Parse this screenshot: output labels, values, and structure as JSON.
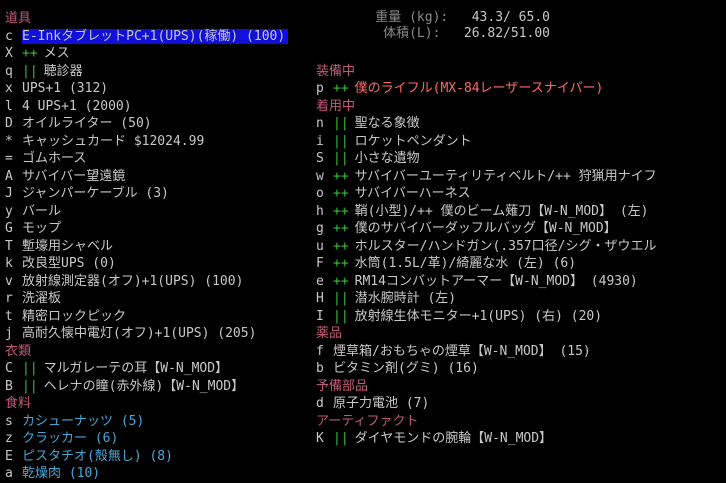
{
  "stats": {
    "weight_label": "重量 (kg):",
    "weight_value": "43.3/ 65.0",
    "volume_label": "体積(L):",
    "volume_value": "26.82/51.00"
  },
  "colors": {
    "background": "#000000",
    "section_header": "#c25a7a",
    "selection_bg": "#1010d8",
    "marker_green": "#3cbf3c",
    "item_default": "#c8c8c8",
    "item_red": "#ff6a6a",
    "item_cyan": "#48a8d8"
  },
  "left": [
    {
      "type": "section",
      "label": "道具"
    },
    {
      "type": "item",
      "key": "c",
      "marker": "",
      "text": "E-InkタブレットPC+1(UPS)(稼働) (100)",
      "color": "def",
      "selected": true
    },
    {
      "type": "item",
      "key": "X",
      "marker": "++",
      "text": "メス",
      "color": "def"
    },
    {
      "type": "item",
      "key": "q",
      "marker": "||",
      "text": "聴診器",
      "color": "def"
    },
    {
      "type": "item",
      "key": "x",
      "marker": "",
      "text": "UPS+1 (312)",
      "color": "def"
    },
    {
      "type": "item",
      "key": "l",
      "marker": "",
      "text": "4 UPS+1 (2000)",
      "color": "def"
    },
    {
      "type": "item",
      "key": "D",
      "marker": "",
      "text": "オイルライター (50)",
      "color": "def"
    },
    {
      "type": "item",
      "key": "*",
      "marker": "",
      "text": "キャッシュカード $12024.99",
      "color": "def"
    },
    {
      "type": "item",
      "key": "=",
      "marker": "",
      "text": "ゴムホース",
      "color": "def"
    },
    {
      "type": "item",
      "key": "A",
      "marker": "",
      "text": "サバイバー望遠鏡",
      "color": "def"
    },
    {
      "type": "item",
      "key": "J",
      "marker": "",
      "text": "ジャンパーケーブル (3)",
      "color": "def"
    },
    {
      "type": "item",
      "key": "y",
      "marker": "",
      "text": "バール",
      "color": "def"
    },
    {
      "type": "item",
      "key": "G",
      "marker": "",
      "text": "モップ",
      "color": "def"
    },
    {
      "type": "item",
      "key": "T",
      "marker": "",
      "text": "塹壕用シャベル",
      "color": "def"
    },
    {
      "type": "item",
      "key": "k",
      "marker": "",
      "text": "改良型UPS (0)",
      "color": "def"
    },
    {
      "type": "item",
      "key": "v",
      "marker": "",
      "text": "放射線測定器(オフ)+1(UPS) (100)",
      "color": "def"
    },
    {
      "type": "item",
      "key": "r",
      "marker": "",
      "text": "洗濯板",
      "color": "def"
    },
    {
      "type": "item",
      "key": "t",
      "marker": "",
      "text": "精密ロックピック",
      "color": "def"
    },
    {
      "type": "item",
      "key": "j",
      "marker": "",
      "text": "高耐久懐中電灯(オフ)+1(UPS) (205)",
      "color": "def"
    },
    {
      "type": "section",
      "label": "衣類"
    },
    {
      "type": "item",
      "key": "C",
      "marker": "||",
      "text": "マルガレーテの耳【W-N_MOD】",
      "color": "def"
    },
    {
      "type": "item",
      "key": "B",
      "marker": "||",
      "text": "ヘレナの瞳(赤外線)【W-N_MOD】",
      "color": "def"
    },
    {
      "type": "section",
      "label": "食料"
    },
    {
      "type": "item",
      "key": "s",
      "marker": "",
      "text": "カシューナッツ (5)",
      "color": "cyan"
    },
    {
      "type": "item",
      "key": "z",
      "marker": "",
      "text": "クラッカー (6)",
      "color": "cyan"
    },
    {
      "type": "item",
      "key": "E",
      "marker": "",
      "text": "ピスタチオ(殻無し) (8)",
      "color": "cyan"
    },
    {
      "type": "item",
      "key": "a",
      "marker": "",
      "text": "乾燥肉 (10)",
      "color": "cyan"
    }
  ],
  "right": [
    {
      "type": "spacer"
    },
    {
      "type": "spacer"
    },
    {
      "type": "spacer"
    },
    {
      "type": "section",
      "label": "装備中"
    },
    {
      "type": "item",
      "key": "p",
      "marker": "++",
      "text": "僕のライフル(MX-84レーザースナイパー)",
      "color": "red"
    },
    {
      "type": "section",
      "label": "着用中"
    },
    {
      "type": "item",
      "key": "n",
      "marker": "||",
      "text": "聖なる象徴",
      "color": "def"
    },
    {
      "type": "item",
      "key": "i",
      "marker": "||",
      "text": "ロケットペンダント",
      "color": "def"
    },
    {
      "type": "item",
      "key": "S",
      "marker": "||",
      "text": "小さな遺物",
      "color": "def"
    },
    {
      "type": "item",
      "key": "w",
      "marker": "++",
      "text": "サバイバーユーティリティベルト/++ 狩猟用ナイフ",
      "color": "def"
    },
    {
      "type": "item",
      "key": "o",
      "marker": "++",
      "text": "サバイバーハーネス",
      "color": "def"
    },
    {
      "type": "item",
      "key": "h",
      "marker": "++",
      "text": "鞘(小型)/++ 僕のビーム薙刀【W-N_MOD】 (左)",
      "color": "def"
    },
    {
      "type": "item",
      "key": "g",
      "marker": "++",
      "text": "僕のサバイバーダッフルバッグ【W-N_MOD】",
      "color": "def"
    },
    {
      "type": "item",
      "key": "u",
      "marker": "++",
      "text": "ホルスター/ハンドガン(.357口径/シグ・ザウエル",
      "color": "def"
    },
    {
      "type": "item",
      "key": "F",
      "marker": "++",
      "text": "水筒(1.5L/革)/綺麗な水 (左) (6)",
      "color": "def"
    },
    {
      "type": "item",
      "key": "e",
      "marker": "++",
      "text": "RM14コンバットアーマー【W-N_MOD】 (4930)",
      "color": "def"
    },
    {
      "type": "item",
      "key": "H",
      "marker": "||",
      "text": "潜水腕時計 (左)",
      "color": "def"
    },
    {
      "type": "item",
      "key": "I",
      "marker": "||",
      "text": "放射線生体モニター+1(UPS) (右) (20)",
      "color": "def"
    },
    {
      "type": "section",
      "label": "薬品"
    },
    {
      "type": "item",
      "key": "f",
      "marker": "",
      "text": "煙草箱/おもちゃの煙草【W-N_MOD】 (15)",
      "color": "def"
    },
    {
      "type": "item",
      "key": "b",
      "marker": "",
      "text": "ビタミン剤(グミ) (16)",
      "color": "def"
    },
    {
      "type": "section",
      "label": "予備部品"
    },
    {
      "type": "item",
      "key": "d",
      "marker": "",
      "text": "原子力電池 (7)",
      "color": "def"
    },
    {
      "type": "section",
      "label": "アーティファクト"
    },
    {
      "type": "item",
      "key": "K",
      "marker": "||",
      "text": "ダイヤモンドの腕輪【W-N_MOD】",
      "color": "def"
    }
  ]
}
